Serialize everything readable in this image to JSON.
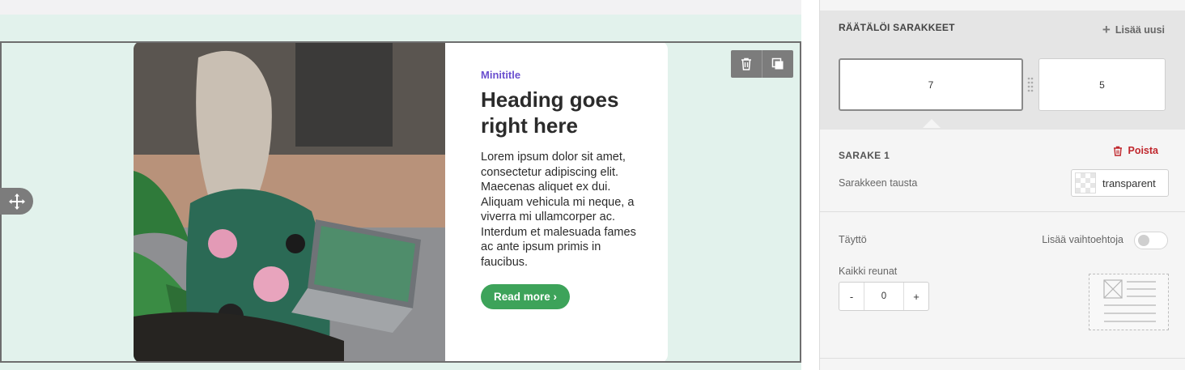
{
  "canvas": {
    "card": {
      "minititle": "Minititle",
      "heading": "Heading goes right here",
      "body": "Lorem ipsum dolor sit amet, consectetur adipiscing elit. Maecenas aliquet ex dui. Aliquam vehicula mi neque, a viverra mi ullamcorper ac. Interdum et malesuada fames ac ante ipsum primis in faucibus.",
      "button_label": "Read more ›"
    },
    "tools": {
      "delete_icon": "trash-icon",
      "duplicate_icon": "duplicate-icon",
      "move_icon": "move-icon"
    }
  },
  "panel": {
    "columns_title": "RÄÄTÄLÖI SARAKKEET",
    "add_new": "Lisää uusi",
    "columns": [
      "7",
      "5"
    ],
    "column_section_title": "SARAKE 1",
    "delete_label": "Poista",
    "background_label": "Sarakkeen tausta",
    "background_value": "transparent",
    "padding_label": "Täyttö",
    "more_options_label": "Lisää vaihtoehtoja",
    "more_options_enabled": false,
    "all_edges_label": "Kaikki reunat",
    "stepper": {
      "minus": "-",
      "value": "0",
      "plus": "+"
    }
  },
  "colors": {
    "canvas_band": "#e2f2ec",
    "minititle": "#6a4fcf",
    "button": "#3da35a",
    "delete": "#c0272d"
  }
}
